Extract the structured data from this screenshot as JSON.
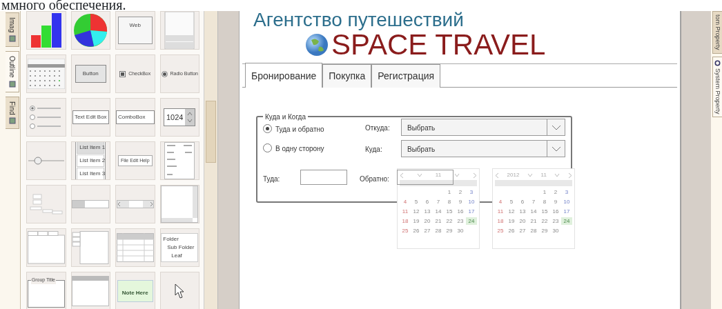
{
  "caption": "ммного обеспечения.",
  "side_tabs": [
    {
      "label": "Imag",
      "selected": false
    },
    {
      "label": "Outline",
      "selected": true
    },
    {
      "label": "Find",
      "selected": false
    }
  ],
  "palette": [
    {
      "kind": "bar-chart"
    },
    {
      "kind": "pie-chart"
    },
    {
      "kind": "browser",
      "label": "Web"
    },
    {
      "kind": "window"
    },
    {
      "kind": "calendar"
    },
    {
      "kind": "button",
      "label": "Button"
    },
    {
      "kind": "checkbox",
      "label": "CheckBox",
      "checked": true
    },
    {
      "kind": "radio",
      "label": "Radio Button",
      "selected": true
    },
    {
      "kind": "radio-group"
    },
    {
      "kind": "textbox",
      "label": "Text Edit Box"
    },
    {
      "kind": "combobox",
      "label": "ComboBox"
    },
    {
      "kind": "spinner",
      "label": "1024"
    },
    {
      "kind": "slider"
    },
    {
      "kind": "listbox",
      "items": [
        "List Item 1",
        "List Item 2",
        "List Item 3"
      ]
    },
    {
      "kind": "menubar",
      "label": "File Edit Help"
    },
    {
      "kind": "menu"
    },
    {
      "kind": "form-sketch"
    },
    {
      "kind": "progress"
    },
    {
      "kind": "hscroll"
    },
    {
      "kind": "scroll-panel"
    },
    {
      "kind": "tabs"
    },
    {
      "kind": "vtabs"
    },
    {
      "kind": "grid"
    },
    {
      "kind": "tree",
      "items": [
        "Folder",
        "Sub Folder",
        "Leaf"
      ]
    },
    {
      "kind": "group",
      "label": "Group Title"
    },
    {
      "kind": "frame"
    },
    {
      "kind": "note",
      "label": "Note Here"
    },
    {
      "kind": "pointer"
    }
  ],
  "header": {
    "subtitle": "Агентство путешествий",
    "title": "SPACE TRAVEL"
  },
  "tabs": [
    {
      "label": "Бронирование",
      "selected": true
    },
    {
      "label": "Покупка",
      "selected": false
    },
    {
      "label": "Регистрация",
      "selected": false
    }
  ],
  "group": {
    "title": "Куда и Когда",
    "trip_options": [
      {
        "label": "Туда и обратно",
        "selected": true
      },
      {
        "label": "В одну сторону",
        "selected": false
      }
    ],
    "from": {
      "label": "Откуда:",
      "value": "Выбрать"
    },
    "to": {
      "label": "Куда:",
      "value": "Выбрать"
    },
    "depart": {
      "label": "Туда:"
    },
    "return": {
      "label": "Обратно:"
    }
  },
  "calendars": [
    {
      "month": "11",
      "weeks": [
        [
          {
            "d": "1",
            "selected": false
          },
          {
            "d": "2",
            "selected": false
          },
          {
            "d": "3",
            "selected": false
          }
        ],
        [
          {
            "d": "4",
            "selected": false
          },
          {
            "d": "5",
            "selected": false
          },
          {
            "d": "6",
            "selected": false
          },
          {
            "d": "7",
            "selected": false
          },
          {
            "d": "8",
            "selected": false
          },
          {
            "d": "9",
            "selected": false
          },
          {
            "d": "10",
            "selected": false
          }
        ],
        [
          {
            "d": "11",
            "selected": false
          },
          {
            "d": "12",
            "selected": false
          },
          {
            "d": "13",
            "selected": false
          },
          {
            "d": "14",
            "selected": false
          },
          {
            "d": "15",
            "selected": false
          },
          {
            "d": "16",
            "selected": false
          },
          {
            "d": "17",
            "selected": false
          }
        ],
        [
          {
            "d": "18",
            "selected": false
          },
          {
            "d": "19",
            "selected": false
          },
          {
            "d": "20",
            "selected": false
          },
          {
            "d": "21",
            "selected": false
          },
          {
            "d": "22",
            "selected": false
          },
          {
            "d": "23",
            "selected": false
          },
          {
            "d": "24",
            "selected": true
          }
        ],
        [
          {
            "d": "25",
            "selected": false
          },
          {
            "d": "26",
            "selected": false
          },
          {
            "d": "27",
            "selected": false
          },
          {
            "d": "28",
            "selected": false
          },
          {
            "d": "29",
            "selected": false
          },
          {
            "d": "30",
            "selected": false
          }
        ]
      ]
    },
    {
      "year": "2012",
      "month": "11",
      "weeks": [
        [
          {
            "d": "1",
            "selected": false
          },
          {
            "d": "2",
            "selected": false
          },
          {
            "d": "3",
            "selected": false
          }
        ],
        [
          {
            "d": "4",
            "selected": false
          },
          {
            "d": "5",
            "selected": false
          },
          {
            "d": "6",
            "selected": false
          },
          {
            "d": "7",
            "selected": false
          },
          {
            "d": "8",
            "selected": false
          },
          {
            "d": "9",
            "selected": false
          },
          {
            "d": "10",
            "selected": false
          }
        ],
        [
          {
            "d": "11",
            "selected": false
          },
          {
            "d": "12",
            "selected": false
          },
          {
            "d": "13",
            "selected": false
          },
          {
            "d": "14",
            "selected": false
          },
          {
            "d": "15",
            "selected": false
          },
          {
            "d": "16",
            "selected": false
          },
          {
            "d": "17",
            "selected": false
          }
        ],
        [
          {
            "d": "18",
            "selected": false
          },
          {
            "d": "19",
            "selected": false
          },
          {
            "d": "20",
            "selected": false
          },
          {
            "d": "21",
            "selected": false
          },
          {
            "d": "22",
            "selected": false
          },
          {
            "d": "23",
            "selected": false
          },
          {
            "d": "24",
            "selected": true
          }
        ],
        [
          {
            "d": "25",
            "selected": false
          },
          {
            "d": "26",
            "selected": false
          },
          {
            "d": "27",
            "selected": false
          },
          {
            "d": "28",
            "selected": false
          },
          {
            "d": "29",
            "selected": false
          },
          {
            "d": "30",
            "selected": false
          }
        ]
      ]
    }
  ],
  "right_tabs": [
    {
      "label": "tom Property",
      "selected": false
    },
    {
      "label": "System Property",
      "selected": true
    }
  ]
}
